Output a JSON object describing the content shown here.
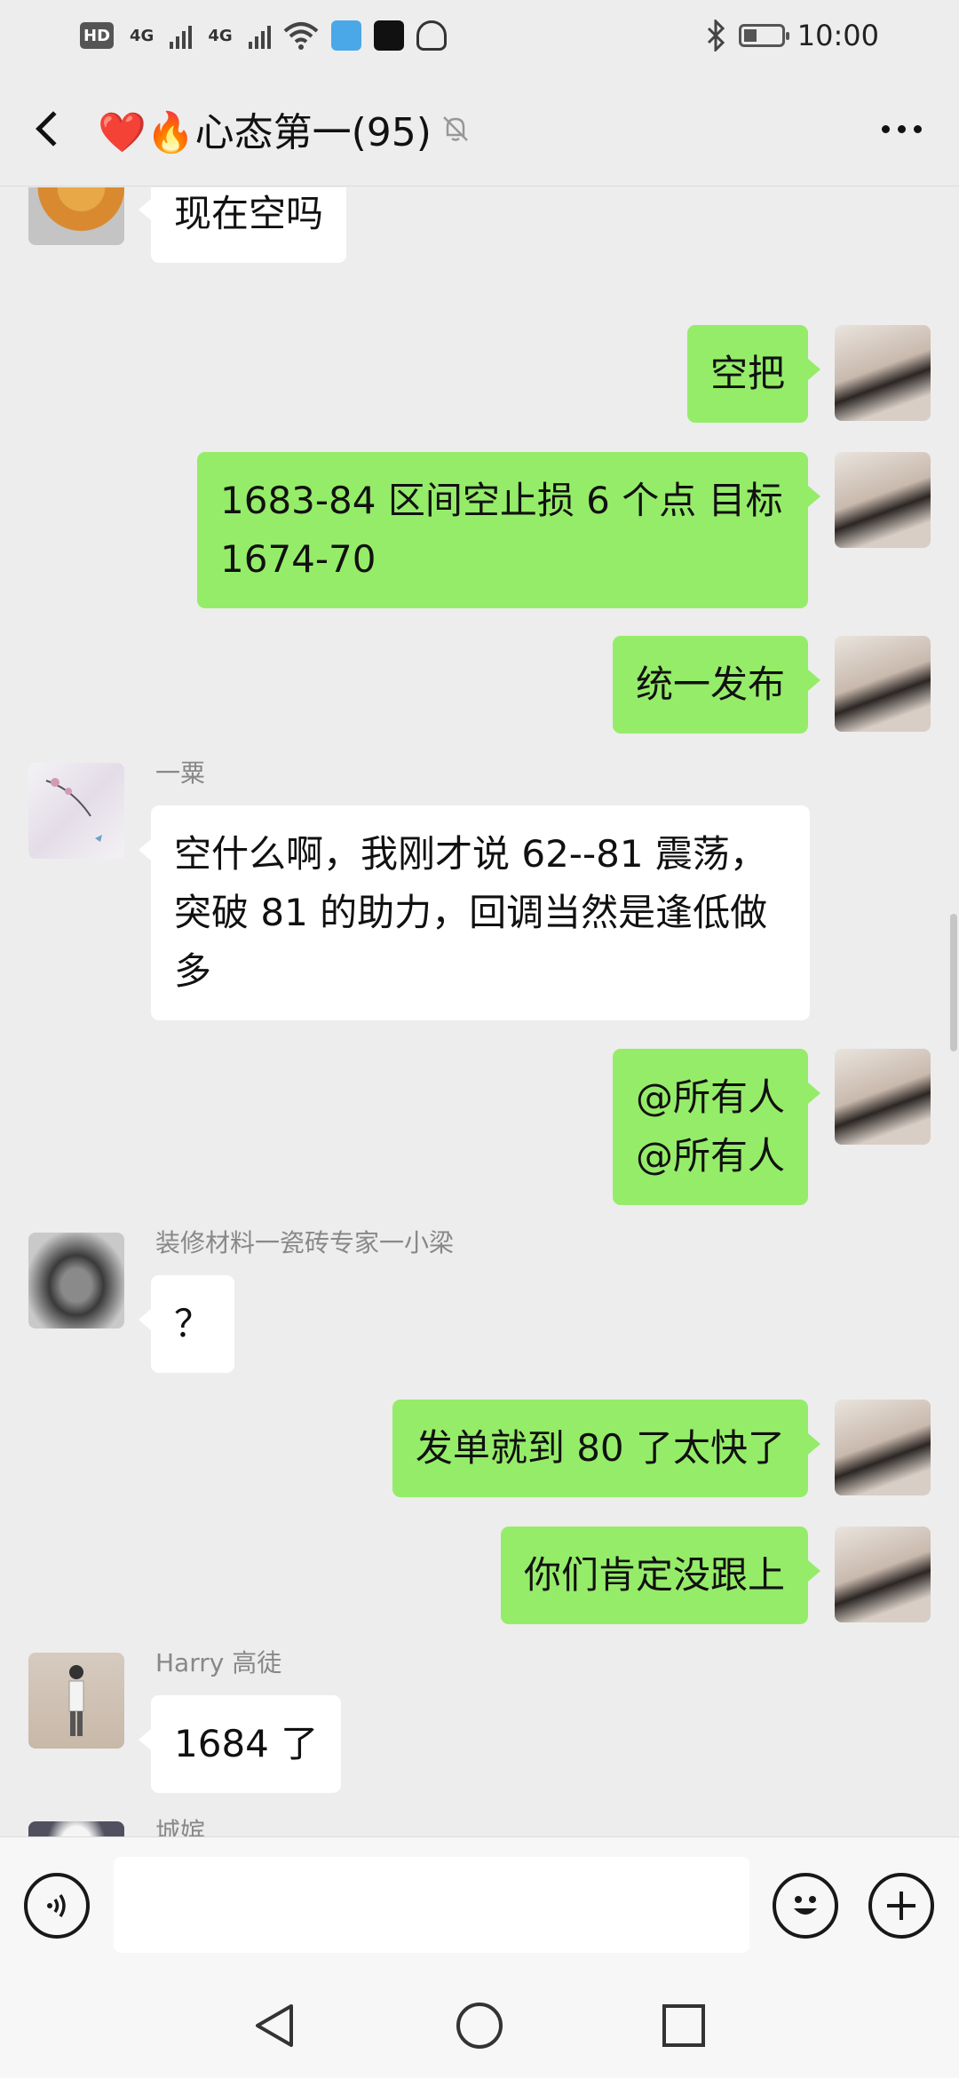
{
  "status_bar": {
    "time": "10:00",
    "network_labels": [
      "HD",
      "4G",
      "4G"
    ]
  },
  "header": {
    "title": "❤️🔥心态第一(95)"
  },
  "messages": [
    {
      "side": "left",
      "sender": "",
      "text": "现在空吗"
    },
    {
      "side": "right",
      "text": "空把"
    },
    {
      "side": "right",
      "text": "1683-84 区间空止损 6 个点 目标 1674-70"
    },
    {
      "side": "right",
      "text": "统一发布"
    },
    {
      "side": "left",
      "sender": "一粟",
      "text": "空什么啊，我刚才说 62--81 震荡，突破 81 的助力，回调当然是逢低做多"
    },
    {
      "side": "right",
      "text": "@所有人\n@所有人"
    },
    {
      "side": "left",
      "sender": "装修材料一瓷砖专家一小梁",
      "text": "？"
    },
    {
      "side": "right",
      "text": "发单就到 80 了太快了"
    },
    {
      "side": "right",
      "text": "你们肯定没跟上"
    },
    {
      "side": "left",
      "sender": "Harry 高徒",
      "text": "1684 了"
    },
    {
      "side": "left",
      "sender": "城嫔",
      "text": ""
    }
  ],
  "colors": {
    "background": "#ededed",
    "sent_bubble": "#95ec69",
    "received_bubble": "#ffffff"
  }
}
